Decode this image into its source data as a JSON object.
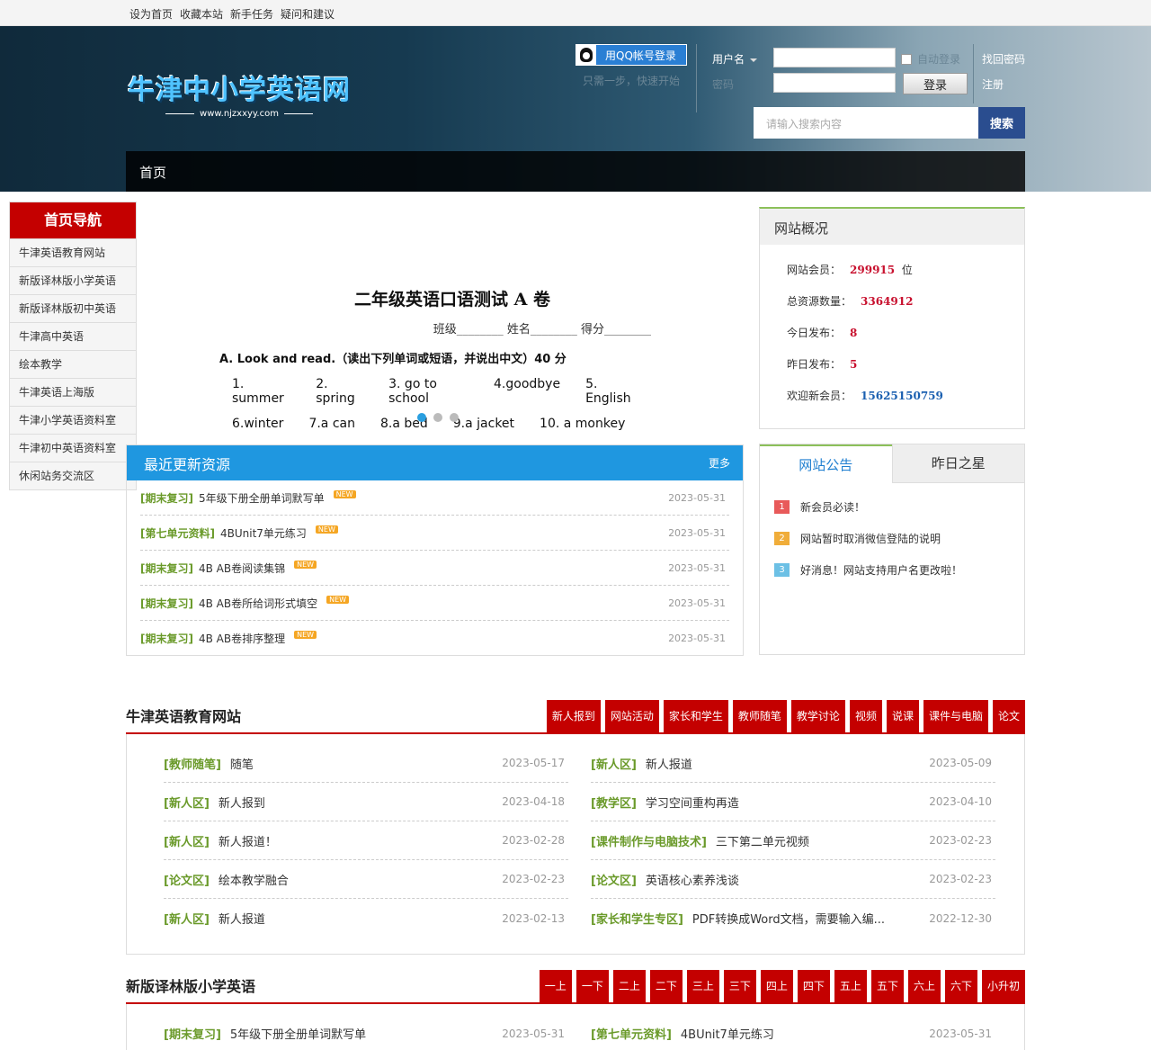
{
  "topbar": [
    "设为首页",
    "收藏本站",
    "新手任务",
    "疑问和建议"
  ],
  "header": {
    "logo_name": "牛津中小学英语网",
    "logo_url": "www.njzxxyy.com",
    "qq_login": "用QQ帐号登录",
    "quick": "只需一步，快速开始",
    "username_label": "用户名",
    "password_label": "密码",
    "auto_login": "自动登录",
    "login_btn": "登录",
    "find_pwd": "找回密码",
    "register": "注册",
    "search_placeholder": "请输入搜索内容",
    "search_btn": "搜索",
    "nav": [
      "首页"
    ]
  },
  "leftnav": {
    "title": "首页导航",
    "items": [
      "牛津英语教育网站",
      "新版译林版小学英语",
      "新版译林版初中英语",
      "牛津高中英语",
      "绘本教学",
      "牛津英语上海版",
      "牛津小学英语资料室",
      "牛津初中英语资料室",
      "休闲站务交流区"
    ]
  },
  "slider": {
    "title": "二年级英语口语测试 A 卷",
    "fields": "班级________ 姓名________ 得分________",
    "question": "A. Look and read.（读出下列单词或短语，并说出中文）40 分",
    "row1": [
      "1. summer",
      "2. spring",
      "3. go to school",
      "4.goodbye",
      "5. English"
    ],
    "row2": [
      "6.winter",
      "7.a can",
      "8.a bed",
      "9.a jacket",
      "10. a monkey"
    ]
  },
  "recent": {
    "title": "最近更新资源",
    "more": "更多",
    "new_badge": "NEW",
    "items": [
      {
        "cat": "[期末复习]",
        "title": "5年级下册全册单词默写单",
        "date": "2023-05-31"
      },
      {
        "cat": "[第七单元资料]",
        "title": "4BUnit7单元练习",
        "date": "2023-05-31"
      },
      {
        "cat": "[期末复习]",
        "title": "4B AB卷阅读集锦",
        "date": "2023-05-31"
      },
      {
        "cat": "[期末复习]",
        "title": "4B AB卷所给词形式填空",
        "date": "2023-05-31"
      },
      {
        "cat": "[期末复习]",
        "title": "4B AB卷排序整理",
        "date": "2023-05-31"
      }
    ]
  },
  "stats": {
    "title": "网站概况",
    "items": [
      {
        "label": "网站会员：",
        "value": "299915",
        "suffix": "位"
      },
      {
        "label": "总资源数量：",
        "value": "3364912",
        "suffix": ""
      },
      {
        "label": "今日发布：",
        "value": "8",
        "suffix": ""
      },
      {
        "label": "昨日发布：",
        "value": "5",
        "suffix": ""
      },
      {
        "label": "欢迎新会员：",
        "value": "15625150759",
        "suffix": ""
      }
    ]
  },
  "notice": {
    "tab_active": "网站公告",
    "tab_other": "昨日之星",
    "items": [
      {
        "num": "1",
        "text": "新会员必读！",
        "color": "#e85a5a"
      },
      {
        "num": "2",
        "text": "网站暂时取消微信登陆的说明",
        "color": "#f0ad3a"
      },
      {
        "num": "3",
        "text": "好消息！网站支持用户名更改啦！",
        "color": "#6cc0e5"
      }
    ]
  },
  "section1": {
    "title": "牛津英语教育网站",
    "tabs": [
      "新人报到",
      "网站活动",
      "家长和学生",
      "教师随笔",
      "教学讨论",
      "视频",
      "说课",
      "课件与电脑",
      "论文"
    ],
    "left": [
      {
        "cat": "[教师随笔]",
        "title": "随笔",
        "date": "2023-05-17"
      },
      {
        "cat": "[新人区]",
        "title": "新人报到",
        "date": "2023-04-18"
      },
      {
        "cat": "[新人区]",
        "title": "新人报道！",
        "date": "2023-02-28"
      },
      {
        "cat": "[论文区]",
        "title": "绘本教学融合",
        "date": "2023-02-23"
      },
      {
        "cat": "[新人区]",
        "title": "新人报道",
        "date": "2023-02-13"
      }
    ],
    "right": [
      {
        "cat": "[新人区]",
        "title": "新人报道",
        "date": "2023-05-09"
      },
      {
        "cat": "[教学区]",
        "title": "学习空间重构再造",
        "date": "2023-04-10"
      },
      {
        "cat": "[课件制作与电脑技术]",
        "title": "三下第二单元视频",
        "date": "2023-02-23"
      },
      {
        "cat": "[论文区]",
        "title": "英语核心素养浅谈",
        "date": "2023-02-23"
      },
      {
        "cat": "[家长和学生专区]",
        "title": "PDF转换成Word文档，需要输入编...",
        "date": "2022-12-30"
      }
    ]
  },
  "section2": {
    "title": "新版译林版小学英语",
    "tabs": [
      "一上",
      "一下",
      "二上",
      "二下",
      "三上",
      "三下",
      "四上",
      "四下",
      "五上",
      "五下",
      "六上",
      "六下",
      "小升初"
    ],
    "left": [
      {
        "cat": "[期末复习]",
        "title": "5年级下册全册单词默写单",
        "date": "2023-05-31"
      }
    ],
    "right": [
      {
        "cat": "[第七单元资料]",
        "title": "4BUnit7单元练习",
        "date": "2023-05-31"
      }
    ]
  }
}
